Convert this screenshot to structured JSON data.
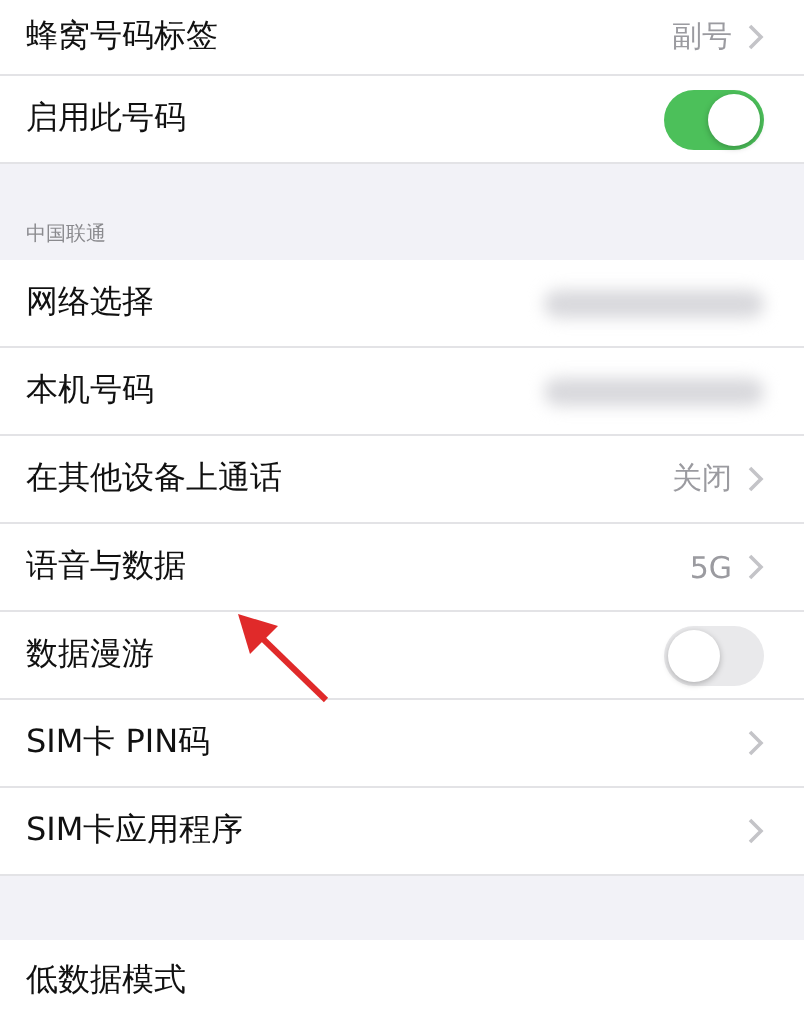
{
  "groups": [
    {
      "rows": [
        {
          "kind": "detail",
          "label": "蜂窝号码标签",
          "value": "副号"
        },
        {
          "kind": "toggle",
          "label": "启用此号码",
          "on": true
        }
      ]
    },
    {
      "header": "中国联通",
      "rows": [
        {
          "kind": "redacted",
          "label": "网络选择"
        },
        {
          "kind": "redacted",
          "label": "本机号码"
        },
        {
          "kind": "detail",
          "label": "在其他设备上通话",
          "value": "关闭"
        },
        {
          "kind": "detail",
          "label": "语音与数据",
          "value": "5G"
        },
        {
          "kind": "toggle",
          "label": "数据漫游",
          "on": false
        },
        {
          "kind": "chevron",
          "label": "SIM卡 PIN码"
        },
        {
          "kind": "chevron",
          "label": "SIM卡应用程序"
        }
      ]
    },
    {
      "rows": [
        {
          "kind": "plain",
          "label": "低数据模式"
        }
      ]
    }
  ],
  "annotation": {
    "kind": "arrow"
  }
}
